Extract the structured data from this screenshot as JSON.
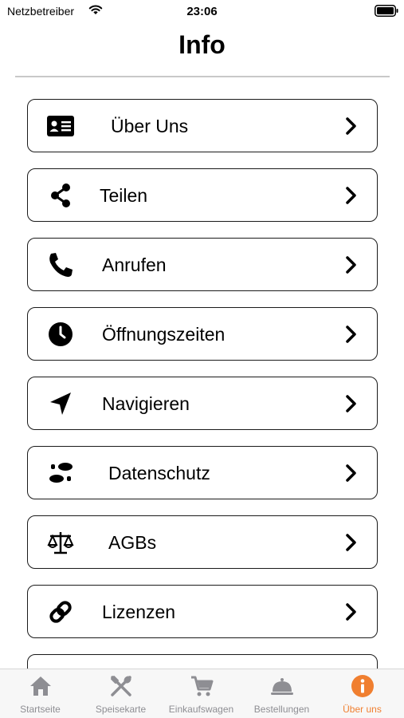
{
  "status_bar": {
    "carrier": "Netzbetreiber",
    "time": "23:06"
  },
  "page": {
    "title": "Info"
  },
  "menu": {
    "items": [
      {
        "label": "Über Uns",
        "icon": "id-card-icon"
      },
      {
        "label": "Teilen",
        "icon": "share-icon"
      },
      {
        "label": "Anrufen",
        "icon": "phone-icon"
      },
      {
        "label": "Öffnungszeiten",
        "icon": "clock-icon"
      },
      {
        "label": "Navigieren",
        "icon": "location-arrow-icon"
      },
      {
        "label": "Datenschutz",
        "icon": "footprints-icon"
      },
      {
        "label": "AGBs",
        "icon": "balance-scale-icon"
      },
      {
        "label": "Lizenzen",
        "icon": "link-icon"
      }
    ]
  },
  "tab_bar": {
    "active_color": "#f07f30",
    "inactive_color": "#8e8e93",
    "tabs": [
      {
        "label": "Startseite",
        "icon": "home-icon"
      },
      {
        "label": "Speisekarte",
        "icon": "utensils-icon"
      },
      {
        "label": "Einkaufswagen",
        "icon": "cart-icon"
      },
      {
        "label": "Bestellungen",
        "icon": "cloche-icon"
      },
      {
        "label": "Über uns",
        "icon": "info-icon",
        "active": true
      }
    ]
  }
}
